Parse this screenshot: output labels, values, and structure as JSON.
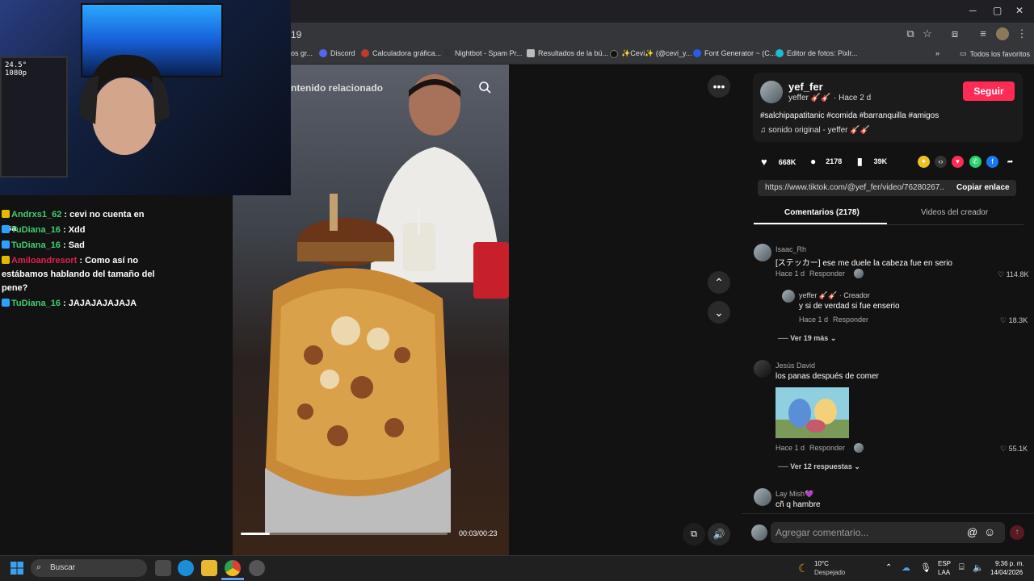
{
  "browser": {
    "url_fragment": "19",
    "bookmarks": [
      {
        "label": "os gr...",
        "color": "#4a86e8"
      },
      {
        "label": "Discord",
        "color": "#5865f2"
      },
      {
        "label": "Calculadora gráfica...",
        "color": "#c0392b"
      },
      {
        "label": "Nightbot - Spam Pr...",
        "color": "#333"
      },
      {
        "label": "Resultados de la bú...",
        "color": "#bbb"
      },
      {
        "label": "✨Cevi✨ (@cevi_y...",
        "color": "#111"
      },
      {
        "label": "Font Generator ~ (C...",
        "color": "#2d5be3"
      },
      {
        "label": "Editor de fotos: Pixlr...",
        "color": "#19c0d0"
      }
    ],
    "all_favorites": "Todos los favoritos"
  },
  "video": {
    "search_placeholder": "ntenido relacionado",
    "time": "00:03/00:23",
    "progress": 0.14
  },
  "webcam": {
    "hud": "24.5°\n1080p"
  },
  "chat": [
    {
      "user": "Andrxs1_62",
      "user_color": "#3ecf6e",
      "badge": "#e6b800",
      "text": "cevi no cuenta en esa"
    },
    {
      "user": "TuDiana_16",
      "user_color": "#3ecf6e",
      "badge": "#2ea0ff",
      "text": "Xdd"
    },
    {
      "user": "TuDiana_16",
      "user_color": "#3ecf6e",
      "badge": "#2ea0ff",
      "text": "Sad"
    },
    {
      "user": "Amiloandresort",
      "user_color": "#e0214c",
      "badge": "#e6b800",
      "text": "Como así no estábamos hablando del tamaño del pene?"
    },
    {
      "user": "TuDiana_16",
      "user_color": "#3ecf6e",
      "badge": "#2ea0ff",
      "text": "JAJAJAJAJAJA"
    }
  ],
  "post": {
    "author": "yef_fer",
    "handle": "yeffer 🎸🎸",
    "age": "· Hace 2 d",
    "follow": "Seguir",
    "hashtags": "#salchipapatitanic #comida #barranquilla #amigos",
    "sound": "♫  sonido original - yeffer 🎸🎸",
    "likes": "668K",
    "comments": "2178",
    "saves": "39K",
    "link": "https://www.tiktok.com/@yef_fer/video/76280267...",
    "copy_link": "Copiar enlace",
    "tab_comments": "Comentarios (2178)",
    "tab_videos": "Videos del creador"
  },
  "comments": [
    {
      "name": "Isaac_Rh",
      "text": "[ステッカー] ese me duele la cabeza fue en serio",
      "meta": "Hace 1 d",
      "reply": "Responder",
      "likes": "114.8K"
    },
    {
      "name": "yeffer 🎸🎸 · Creador",
      "text": "y si de verdad si fue enserio",
      "meta": "Hace 1 d",
      "reply": "Responder",
      "likes": "18.3K"
    },
    {
      "name": "Jesús David",
      "text": "los panas después de comer",
      "meta": "Hace 1 d",
      "reply": "Responder",
      "likes": "55.1K"
    },
    {
      "name": "Lay Mish💜",
      "text": "cñ q hambre"
    }
  ],
  "more_replies_1": "Ver 19 más",
  "more_replies_2": "Ver 12 respuestas",
  "comment_placeholder": "Agregar comentario...",
  "taskbar": {
    "search": "Buscar",
    "weather_temp": "10°C",
    "weather_desc": "Despejado",
    "lang1": "ESP",
    "lang2": "LAA",
    "time": "9:36 p. m.",
    "date": "14/04/2026"
  }
}
